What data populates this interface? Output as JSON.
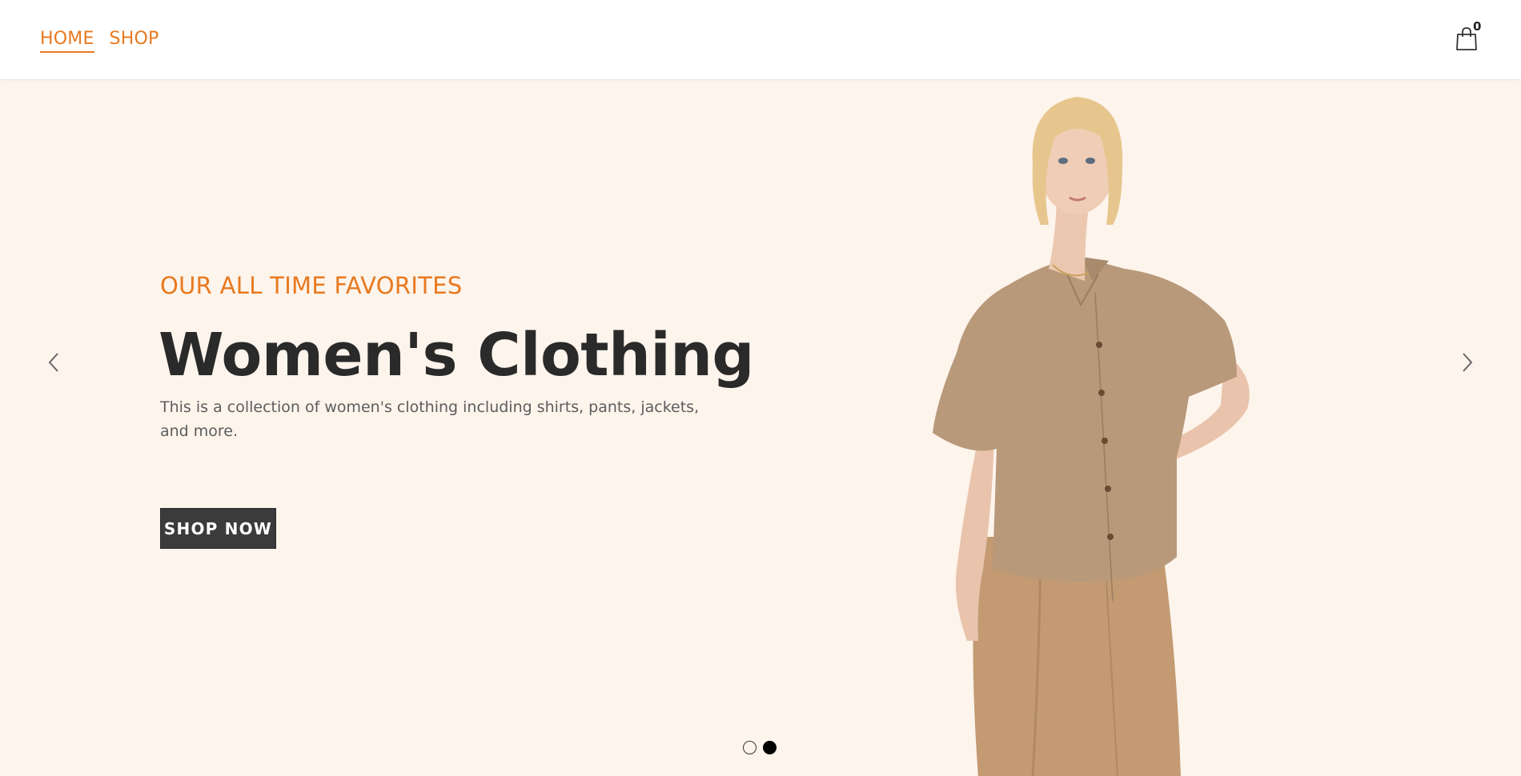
{
  "nav": {
    "items": [
      {
        "label": "HOME",
        "active": true
      },
      {
        "label": "SHOP",
        "active": false
      }
    ]
  },
  "cart": {
    "icon": "shopping-bag-icon",
    "count": "0"
  },
  "hero": {
    "eyebrow": "OUR ALL TIME FAVORITES",
    "title": "Women's Clothing",
    "description": "This is a collection of women's clothing including shirts, pants, jackets, and more.",
    "cta_label": "SHOP NOW",
    "image": "model-in-tan-shirt",
    "slides_total": 2,
    "active_slide": 2
  },
  "carousel": {
    "prev_icon": "chevron-left-icon",
    "next_icon": "chevron-right-icon"
  },
  "colors": {
    "accent": "#e8791f",
    "hero_bg": "#fdf4ec",
    "button_bg": "#3b3b3b",
    "text_dark": "#2a2a2a"
  }
}
